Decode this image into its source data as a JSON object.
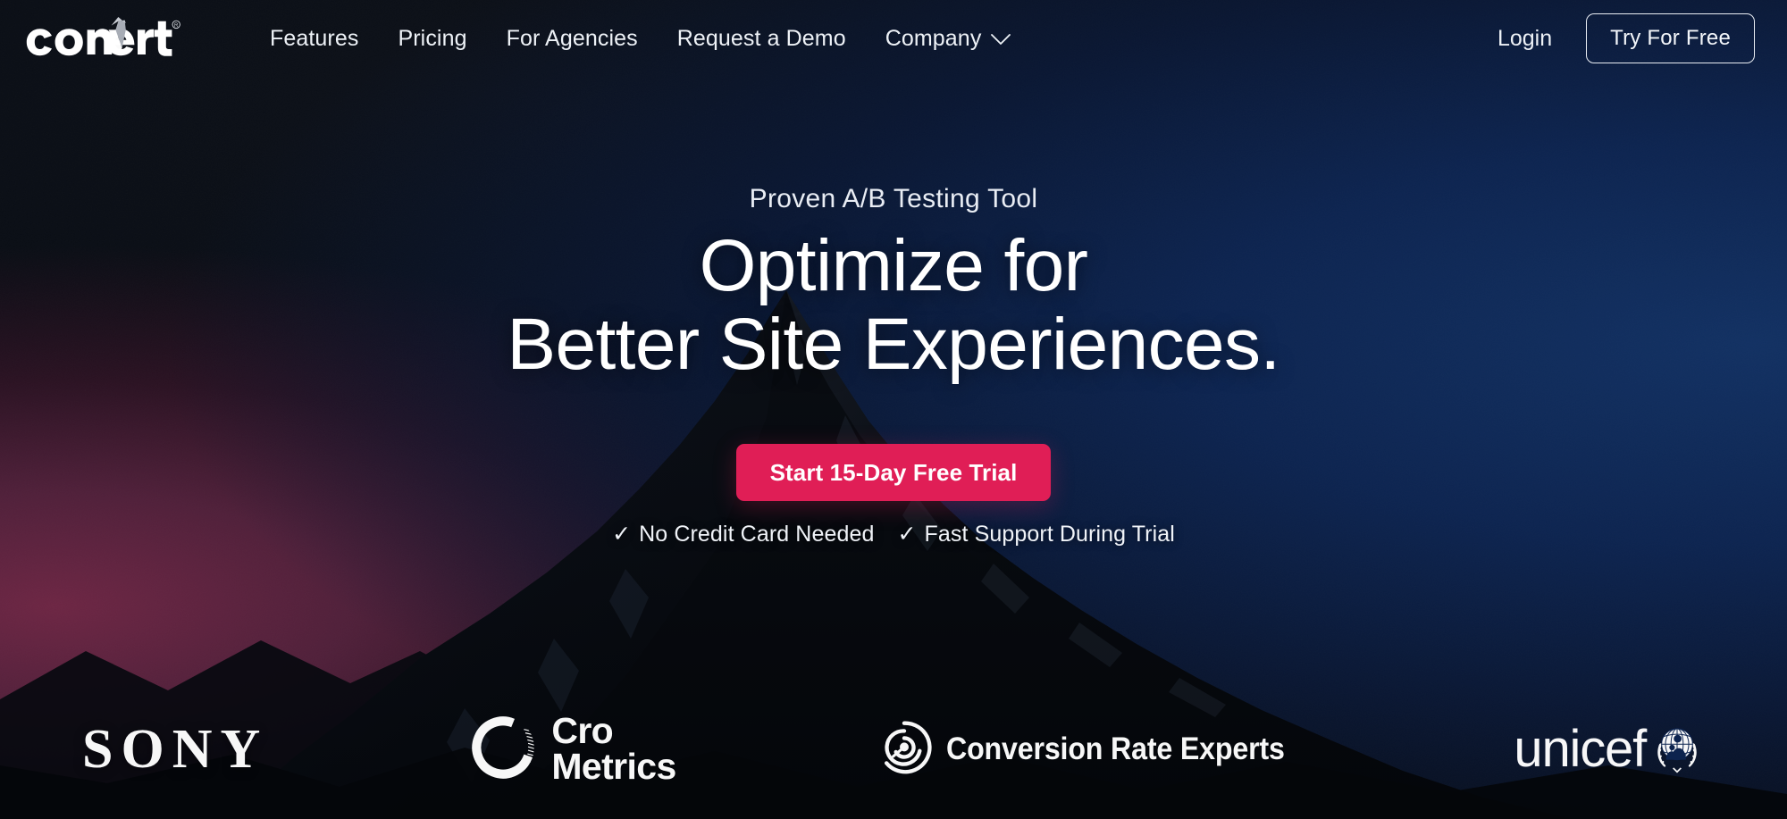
{
  "brand": {
    "logo_text": "convert",
    "logo_trademark": "®",
    "logo_icon": "arrow-up-icon"
  },
  "colors": {
    "cta_pink": "#e01e56",
    "background_navy": "#0d2450",
    "background_dark": "#0a0e15",
    "background_magenta_glow": "#6d2644",
    "text_white": "#ffffff"
  },
  "nav": {
    "items": [
      {
        "label": "Features",
        "has_dropdown": false
      },
      {
        "label": "Pricing",
        "has_dropdown": false
      },
      {
        "label": "For Agencies",
        "has_dropdown": false
      },
      {
        "label": "Request a Demo",
        "has_dropdown": false
      },
      {
        "label": "Company",
        "has_dropdown": true,
        "dropdown_icon": "chevron-down-icon"
      }
    ],
    "login_label": "Login",
    "try_free_label": "Try For Free"
  },
  "hero": {
    "eyebrow": "Proven A/B Testing Tool",
    "headline_line1": "Optimize for",
    "headline_line2": "Better Site Experiences.",
    "cta_label": "Start 15-Day Free Trial",
    "trust_items": [
      {
        "check": "✓",
        "label": "No Credit Card Needed"
      },
      {
        "check": "✓",
        "label": "Fast Support During Trial"
      }
    ]
  },
  "logo_strip": {
    "brands": [
      {
        "name": "Sony",
        "text": "SONY",
        "icon": ""
      },
      {
        "name": "Cro Metrics",
        "text_line1": "Cro",
        "text_line2": "Metrics",
        "icon": "cro-ring-icon"
      },
      {
        "name": "Conversion Rate Experts",
        "text": "Conversion Rate Experts",
        "icon": "maze-circle-icon"
      },
      {
        "name": "UNICEF",
        "text": "unicef",
        "icon": "unicef-globe-icon"
      }
    ]
  }
}
